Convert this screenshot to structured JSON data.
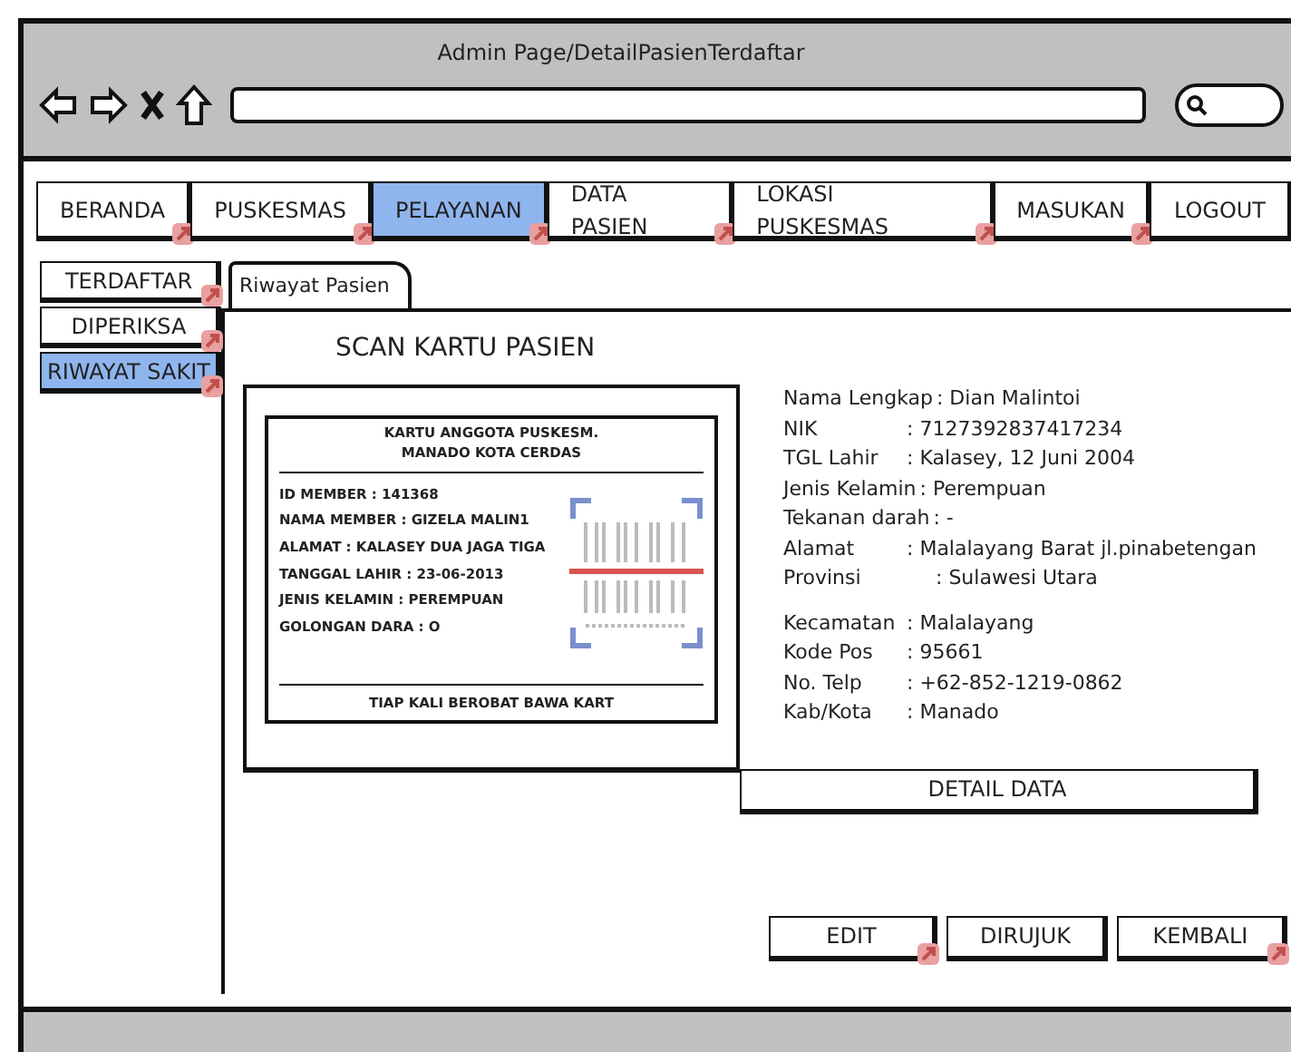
{
  "window": {
    "title": "Admin Page/DetailPasienTerdaftar"
  },
  "nav": [
    {
      "label": "BERANDA",
      "selected": false,
      "link": true
    },
    {
      "label": "PUSKESMAS",
      "selected": false,
      "link": true
    },
    {
      "label": "PELAYANAN",
      "selected": true,
      "link": true
    },
    {
      "label": "DATA PASIEN",
      "selected": false,
      "link": true
    },
    {
      "label": "LOKASI PUSKESMAS",
      "selected": false,
      "link": true
    },
    {
      "label": "MASUKAN",
      "selected": false,
      "link": true
    },
    {
      "label": "LOGOUT",
      "selected": false,
      "link": false
    }
  ],
  "sidebar": [
    {
      "label": "TERDAFTAR",
      "selected": false,
      "link": true
    },
    {
      "label": "DIPERIKSA",
      "selected": false,
      "link": true
    },
    {
      "label": "RIWAYAT SAKIT",
      "selected": true,
      "link": true
    }
  ],
  "tab": {
    "label": "Riwayat Pasien"
  },
  "heading": "SCAN KARTU PASIEN",
  "card": {
    "title": [
      "KARTU ANGGOTA PUSKESM.",
      "MANADO KOTA CERDAS"
    ],
    "lines": [
      "ID MEMBER : 141368",
      "NAMA MEMBER : GIZELA MALIN1",
      "ALAMAT : KALASEY DUA JAGA TIGA",
      "TANGGAL LAHIR : 23-06-2013",
      "JENIS KELAMIN : PEREMPUAN",
      "GOLONGAN DARA : O"
    ],
    "footer": "TIAP KALI BEROBAT BAWA KART"
  },
  "details": [
    [
      {
        "label": "Nama Lengkap",
        "value": ": Dian Malintoi",
        "kind": "inline"
      },
      {
        "label": "NIK",
        "value": ": 7127392837417234",
        "kind": "aligned"
      },
      {
        "label": "TGL Lahir",
        "value": ": Kalasey, 12 Juni 2004",
        "kind": "aligned"
      },
      {
        "label": "Jenis Kelamin",
        "value": ": Perempuan",
        "kind": "inline"
      },
      {
        "label": "Tekanan darah",
        "value": ": -",
        "kind": "inline"
      },
      {
        "label": "Alamat",
        "value": ": Malalayang Barat jl.pinabetengan",
        "kind": "aligned"
      },
      {
        "label": "Provinsi",
        "value": ": Sulawesi Utara",
        "kind": "wide"
      }
    ],
    [
      {
        "label": "Kecamatan",
        "value": ": Malalayang",
        "kind": "aligned"
      },
      {
        "label": "Kode Pos",
        "value": ": 95661",
        "kind": "aligned"
      },
      {
        "label": "No. Telp",
        "value": ":  +62-852-1219-0862",
        "kind": "aligned"
      },
      {
        "label": "Kab/Kota",
        "value": ": Manado",
        "kind": "aligned"
      }
    ]
  ],
  "detail_button": {
    "label": "DETAIL DATA",
    "link": false
  },
  "buttons": [
    {
      "label": "EDIT",
      "link": true
    },
    {
      "label": "DIRUJUK",
      "link": false
    },
    {
      "label": "KEMBALI",
      "link": true
    }
  ]
}
